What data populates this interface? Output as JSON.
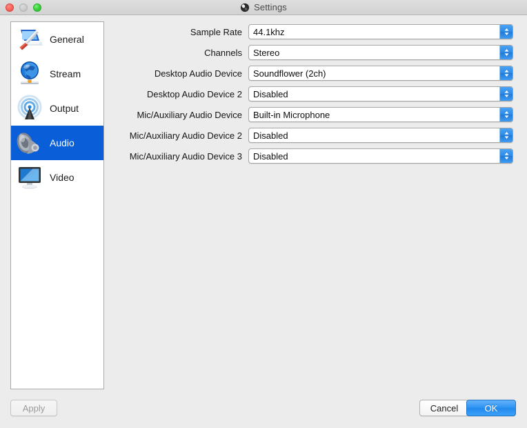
{
  "window": {
    "title": "Settings",
    "title_icon": "obs-logo-icon",
    "traffic_lights": [
      {
        "name": "close-button",
        "color": "#fb6a60"
      },
      {
        "name": "minimize-button",
        "color": "#cfcfcf"
      },
      {
        "name": "zoom-button",
        "color": "#3fd13f"
      }
    ]
  },
  "sidebar": {
    "items": [
      {
        "label": "General",
        "icon": "general-settings-icon",
        "selected": false
      },
      {
        "label": "Stream",
        "icon": "globe-stream-icon",
        "selected": false
      },
      {
        "label": "Output",
        "icon": "broadcast-output-icon",
        "selected": false
      },
      {
        "label": "Audio",
        "icon": "speaker-audio-icon",
        "selected": true
      },
      {
        "label": "Video",
        "icon": "monitor-video-icon",
        "selected": false
      }
    ],
    "selected_color": "#0a5fd8"
  },
  "form": {
    "rows": [
      {
        "label": "Sample Rate",
        "value": "44.1khz"
      },
      {
        "label": "Channels",
        "value": "Stereo"
      },
      {
        "label": "Desktop Audio Device",
        "value": "Soundflower (2ch)"
      },
      {
        "label": "Desktop Audio Device 2",
        "value": "Disabled"
      },
      {
        "label": "Mic/Auxiliary Audio Device",
        "value": "Built-in Microphone"
      },
      {
        "label": "Mic/Auxiliary Audio Device 2",
        "value": "Disabled"
      },
      {
        "label": "Mic/Auxiliary Audio Device 3",
        "value": "Disabled"
      }
    ]
  },
  "footer": {
    "apply_label": "Apply",
    "apply_enabled": false,
    "cancel_label": "Cancel",
    "ok_label": "OK",
    "ok_color": "#2f93f2"
  }
}
